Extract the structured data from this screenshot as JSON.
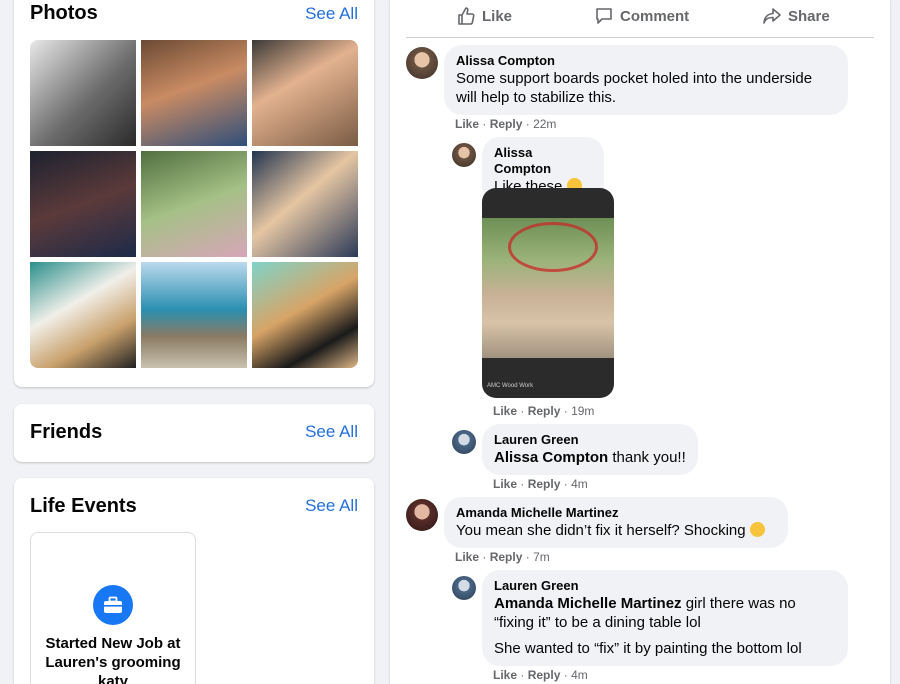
{
  "photos": {
    "title": "Photos",
    "see_all": "See All"
  },
  "friends": {
    "title": "Friends",
    "see_all": "See All"
  },
  "life_events": {
    "title": "Life Events",
    "see_all": "See All",
    "event_text": "Started New Job at Lauren's grooming katy",
    "event_icon": "briefcase-icon"
  },
  "post_actions": {
    "like": "Like",
    "comment": "Comment",
    "share": "Share"
  },
  "comments": [
    {
      "name": "Alissa Compton",
      "text": "Some support boards pocket holed into the underside will help to stabilize this.",
      "like": "Like",
      "reply": "Reply",
      "time": "22m"
    },
    {
      "name": "Alissa Compton",
      "text": "Like these",
      "like": "Like",
      "reply": "Reply",
      "time": "19m",
      "image_caption": "AMC Wood Work"
    },
    {
      "name": "Lauren Green",
      "mention": "Alissa Compton",
      "text": "thank you!!",
      "like": "Like",
      "reply": "Reply",
      "time": "4m"
    },
    {
      "name": "Amanda Michelle Martinez",
      "text": "You mean she didn’t fix it herself? Shocking",
      "like": "Like",
      "reply": "Reply",
      "time": "7m"
    },
    {
      "name": "Lauren Green",
      "mention": "Amanda Michelle Martinez",
      "text_line1": "girl there was no",
      "text_line2": "“fixing it” to be a dining table lol",
      "text_line3": "She wanted to “fix” it by painting the bottom lol",
      "like": "Like",
      "reply": "Reply",
      "time": "4m"
    }
  ],
  "meta_separator": "·",
  "colors": {
    "link": "#216fdb",
    "accent": "#1877f2",
    "bubble": "#f0f2f5",
    "secondary_text": "#65676b"
  }
}
